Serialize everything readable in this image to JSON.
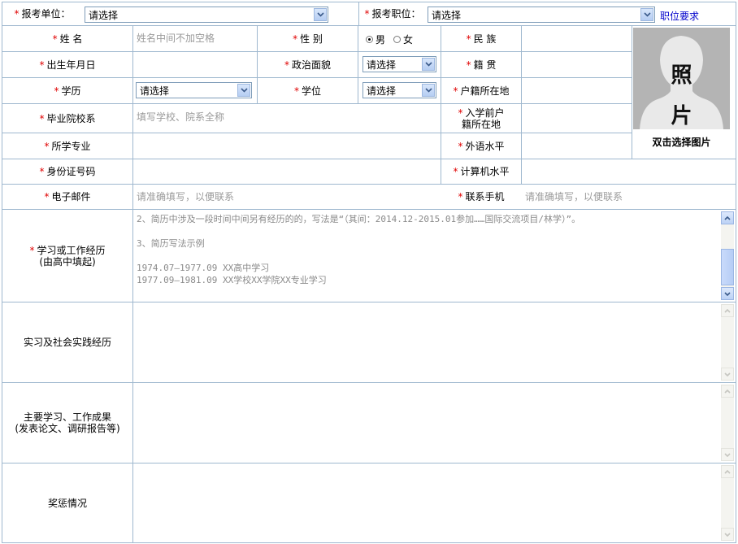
{
  "top": {
    "unit_label": "报考单位：",
    "unit_value": "请选择",
    "position_label": "报考职位：",
    "position_value": "请选择",
    "position_link": "职位要求"
  },
  "fields": {
    "name_label": "姓 名",
    "name_placeholder": "姓名中间不加空格",
    "gender_label": "性 别",
    "gender_male": "男",
    "gender_female": "女",
    "gender_selected": "男",
    "ethnicity_label": "民 族",
    "birth_label": "出生年月日",
    "political_label": "政治面貌",
    "political_value": "请选择",
    "native_label": "籍 贯",
    "education_label": "学历",
    "education_value": "请选择",
    "degree_label": "学位",
    "degree_value": "请选择",
    "hukou_label": "户籍所在地",
    "school_label": "毕业院校系",
    "school_placeholder": "填写学校、院系全称",
    "prehukou_label_1": "入学前户",
    "prehukou_label_2": "籍所在地",
    "major_label": "所学专业",
    "foreign_label": "外语水平",
    "idcard_label": "身份证号码",
    "computer_label": "计算机水平",
    "email_label": "电子邮件",
    "email_placeholder": "请准确填写，以便联系",
    "phone_label": "联系手机",
    "phone_placeholder": "请准确填写，以便联系"
  },
  "photo": {
    "char1": "照",
    "char2": "片",
    "caption": "双击选择图片"
  },
  "sections": {
    "experience_label_1": "学习或工作经历",
    "experience_label_2": "(由高中填起)",
    "experience_lines": [
      "2、简历中涉及一段时间中间另有经历的的，写法是“（其间：2014.12-2015.01参加……国际交流项目/林学）”。",
      "",
      "3、简历写法示例",
      "",
      "1974.07—1977.09 XX高中学习",
      "1977.09—1981.09 XX学校XX学院XX专业学习"
    ],
    "practice_label": "实习及社会实践经历",
    "achievement_label_1": "主要学习、工作成果",
    "achievement_label_2": "(发表论文、调研报告等)",
    "award_label": "奖惩情况"
  },
  "required_mark": "*",
  "colors": {
    "border": "#9fb8cf",
    "required": "#e00000",
    "link": "#0000cc",
    "placeholder": "#9a9a9a"
  }
}
